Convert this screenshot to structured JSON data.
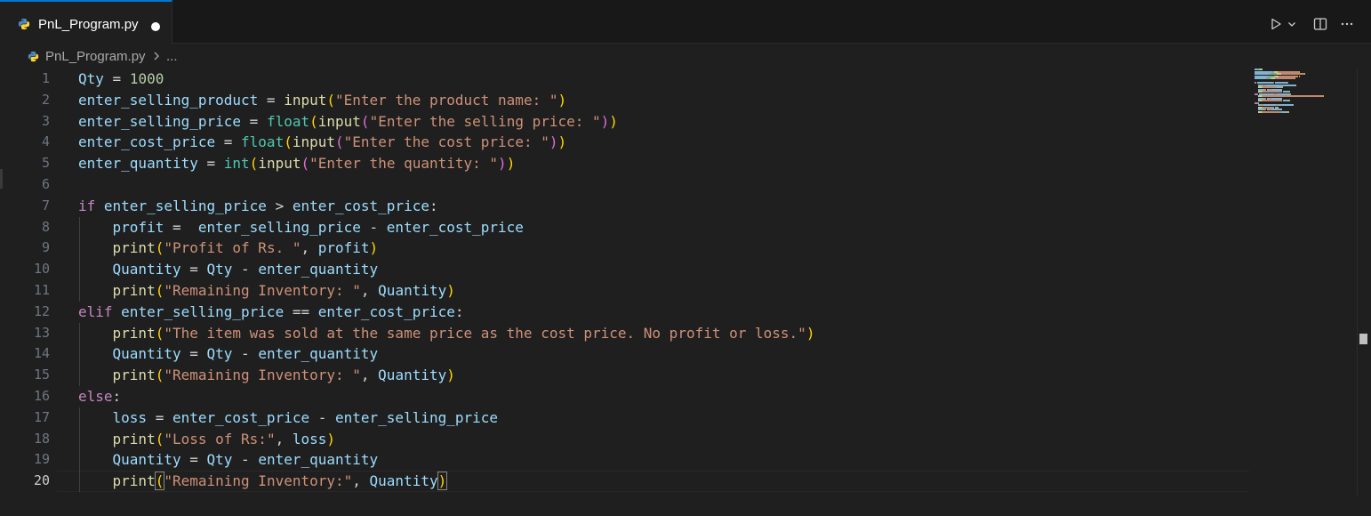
{
  "tab": {
    "filename": "PnL_Program.py",
    "unsaved": true
  },
  "breadcrumb": {
    "file": "PnL_Program.py",
    "more": "..."
  },
  "toolbar": {
    "run_icon": "play-icon",
    "run_menu_icon": "chevron-down-icon",
    "split_icon": "split-editor-icon",
    "more_icon": "ellipsis-icon"
  },
  "editor": {
    "active_line": 20,
    "lines": [
      {
        "n": "1",
        "tokens": [
          [
            "var",
            "Qty"
          ],
          [
            "op",
            " = "
          ],
          [
            "num",
            "1000"
          ]
        ]
      },
      {
        "n": "2",
        "tokens": [
          [
            "var",
            "enter_selling_product"
          ],
          [
            "op",
            " = "
          ],
          [
            "fn",
            "input"
          ],
          [
            "b1",
            "("
          ],
          [
            "str",
            "\"Enter the product name: \""
          ],
          [
            "b1",
            ")"
          ]
        ]
      },
      {
        "n": "3",
        "tokens": [
          [
            "var",
            "enter_selling_price"
          ],
          [
            "op",
            " = "
          ],
          [
            "type",
            "float"
          ],
          [
            "b1",
            "("
          ],
          [
            "fn",
            "input"
          ],
          [
            "b2",
            "("
          ],
          [
            "str",
            "\"Enter the selling price: \""
          ],
          [
            "b2",
            ")"
          ],
          [
            "b1",
            ")"
          ]
        ]
      },
      {
        "n": "4",
        "tokens": [
          [
            "var",
            "enter_cost_price"
          ],
          [
            "op",
            " = "
          ],
          [
            "type",
            "float"
          ],
          [
            "b1",
            "("
          ],
          [
            "fn",
            "input"
          ],
          [
            "b2",
            "("
          ],
          [
            "str",
            "\"Enter the cost price: \""
          ],
          [
            "b2",
            ")"
          ],
          [
            "b1",
            ")"
          ]
        ]
      },
      {
        "n": "5",
        "tokens": [
          [
            "var",
            "enter_quantity"
          ],
          [
            "op",
            " = "
          ],
          [
            "type",
            "int"
          ],
          [
            "b1",
            "("
          ],
          [
            "fn",
            "input"
          ],
          [
            "b2",
            "("
          ],
          [
            "str",
            "\"Enter the quantity: \""
          ],
          [
            "b2",
            ")"
          ],
          [
            "b1",
            ")"
          ]
        ]
      },
      {
        "n": "6",
        "tokens": []
      },
      {
        "n": "7",
        "tokens": [
          [
            "kw",
            "if"
          ],
          [
            "op",
            " "
          ],
          [
            "var",
            "enter_selling_price"
          ],
          [
            "op",
            " > "
          ],
          [
            "var",
            "enter_cost_price"
          ],
          [
            "op",
            ":"
          ]
        ]
      },
      {
        "n": "8",
        "tokens": [
          [
            "op",
            "    "
          ],
          [
            "var",
            "profit"
          ],
          [
            "op",
            " =  "
          ],
          [
            "var",
            "enter_selling_price"
          ],
          [
            "op",
            " - "
          ],
          [
            "var",
            "enter_cost_price"
          ]
        ]
      },
      {
        "n": "9",
        "tokens": [
          [
            "op",
            "    "
          ],
          [
            "fn",
            "print"
          ],
          [
            "b1",
            "("
          ],
          [
            "str",
            "\"Profit of Rs. \""
          ],
          [
            "op",
            ", "
          ],
          [
            "var",
            "profit"
          ],
          [
            "b1",
            ")"
          ]
        ]
      },
      {
        "n": "10",
        "tokens": [
          [
            "op",
            "    "
          ],
          [
            "var",
            "Quantity"
          ],
          [
            "op",
            " = "
          ],
          [
            "var",
            "Qty"
          ],
          [
            "op",
            " - "
          ],
          [
            "var",
            "enter_quantity"
          ]
        ]
      },
      {
        "n": "11",
        "tokens": [
          [
            "op",
            "    "
          ],
          [
            "fn",
            "print"
          ],
          [
            "b1",
            "("
          ],
          [
            "str",
            "\"Remaining Inventory: \""
          ],
          [
            "op",
            ", "
          ],
          [
            "var",
            "Quantity"
          ],
          [
            "b1",
            ")"
          ]
        ]
      },
      {
        "n": "12",
        "tokens": [
          [
            "kw",
            "elif"
          ],
          [
            "op",
            " "
          ],
          [
            "var",
            "enter_selling_price"
          ],
          [
            "op",
            " == "
          ],
          [
            "var",
            "enter_cost_price"
          ],
          [
            "op",
            ":"
          ]
        ]
      },
      {
        "n": "13",
        "tokens": [
          [
            "op",
            "    "
          ],
          [
            "fn",
            "print"
          ],
          [
            "b1",
            "("
          ],
          [
            "str",
            "\"The item was sold at the same price as the cost price. No profit or loss.\""
          ],
          [
            "b1",
            ")"
          ]
        ]
      },
      {
        "n": "14",
        "tokens": [
          [
            "op",
            "    "
          ],
          [
            "var",
            "Quantity"
          ],
          [
            "op",
            " = "
          ],
          [
            "var",
            "Qty"
          ],
          [
            "op",
            " - "
          ],
          [
            "var",
            "enter_quantity"
          ]
        ]
      },
      {
        "n": "15",
        "tokens": [
          [
            "op",
            "    "
          ],
          [
            "fn",
            "print"
          ],
          [
            "b1",
            "("
          ],
          [
            "str",
            "\"Remaining Inventory: \""
          ],
          [
            "op",
            ", "
          ],
          [
            "var",
            "Quantity"
          ],
          [
            "b1",
            ")"
          ]
        ]
      },
      {
        "n": "16",
        "tokens": [
          [
            "kw",
            "else"
          ],
          [
            "op",
            ":"
          ]
        ]
      },
      {
        "n": "17",
        "tokens": [
          [
            "op",
            "    "
          ],
          [
            "var",
            "loss"
          ],
          [
            "op",
            " = "
          ],
          [
            "var",
            "enter_cost_price"
          ],
          [
            "op",
            " - "
          ],
          [
            "var",
            "enter_selling_price"
          ]
        ]
      },
      {
        "n": "18",
        "tokens": [
          [
            "op",
            "    "
          ],
          [
            "fn",
            "print"
          ],
          [
            "b1",
            "("
          ],
          [
            "str",
            "\"Loss of Rs:\""
          ],
          [
            "op",
            ", "
          ],
          [
            "var",
            "loss"
          ],
          [
            "b1",
            ")"
          ]
        ]
      },
      {
        "n": "19",
        "tokens": [
          [
            "op",
            "    "
          ],
          [
            "var",
            "Quantity"
          ],
          [
            "op",
            " = "
          ],
          [
            "var",
            "Qty"
          ],
          [
            "op",
            " - "
          ],
          [
            "var",
            "enter_quantity"
          ]
        ]
      },
      {
        "n": "20",
        "tokens": [
          [
            "op",
            "    "
          ],
          [
            "fn",
            "print"
          ],
          [
            "b1box",
            "("
          ],
          [
            "str",
            "\"Remaining Inventory:\""
          ],
          [
            "op",
            ", "
          ],
          [
            "var",
            "Quantity"
          ],
          [
            "b1box",
            ")"
          ]
        ]
      }
    ]
  },
  "colors": {
    "accent": "#0078d4",
    "background": "#1f1f1f",
    "tab_bar": "#181818"
  }
}
